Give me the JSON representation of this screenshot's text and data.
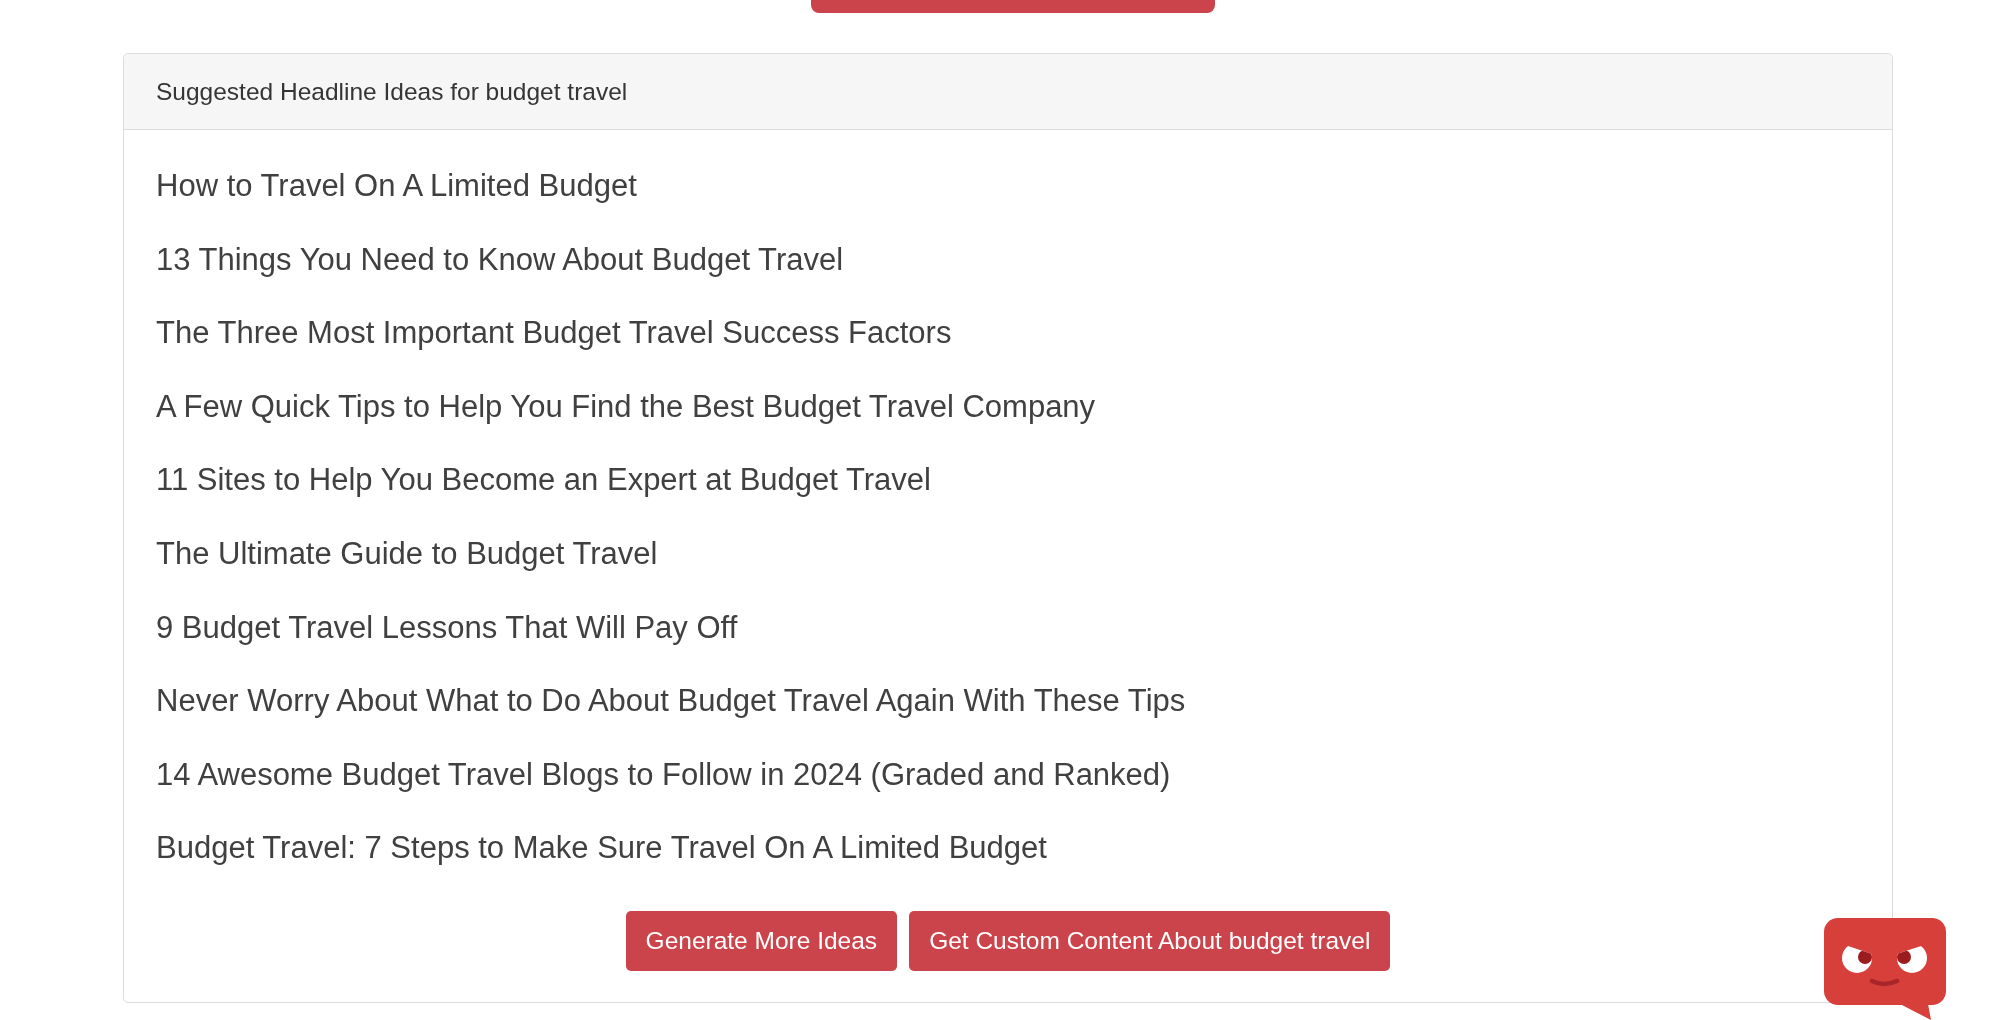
{
  "card": {
    "title": "Suggested Headline Ideas for budget travel",
    "headlines": [
      "How to Travel On A Limited Budget",
      "13 Things You Need to Know About Budget Travel",
      "The Three Most Important Budget Travel Success Factors",
      "A Few Quick Tips to Help You Find the Best Budget Travel Company",
      "11 Sites to Help You Become an Expert at Budget Travel",
      "The Ultimate Guide to Budget Travel",
      "9 Budget Travel Lessons That Will Pay Off",
      "Never Worry About What to Do About Budget Travel Again With These Tips",
      "14 Awesome Budget Travel Blogs to Follow in 2024 (Graded and Ranked)",
      "Budget Travel: 7 Steps to Make Sure Travel On A Limited Budget"
    ],
    "buttons": [
      "Generate More Ideas",
      "Get Custom Content About budget travel"
    ]
  }
}
